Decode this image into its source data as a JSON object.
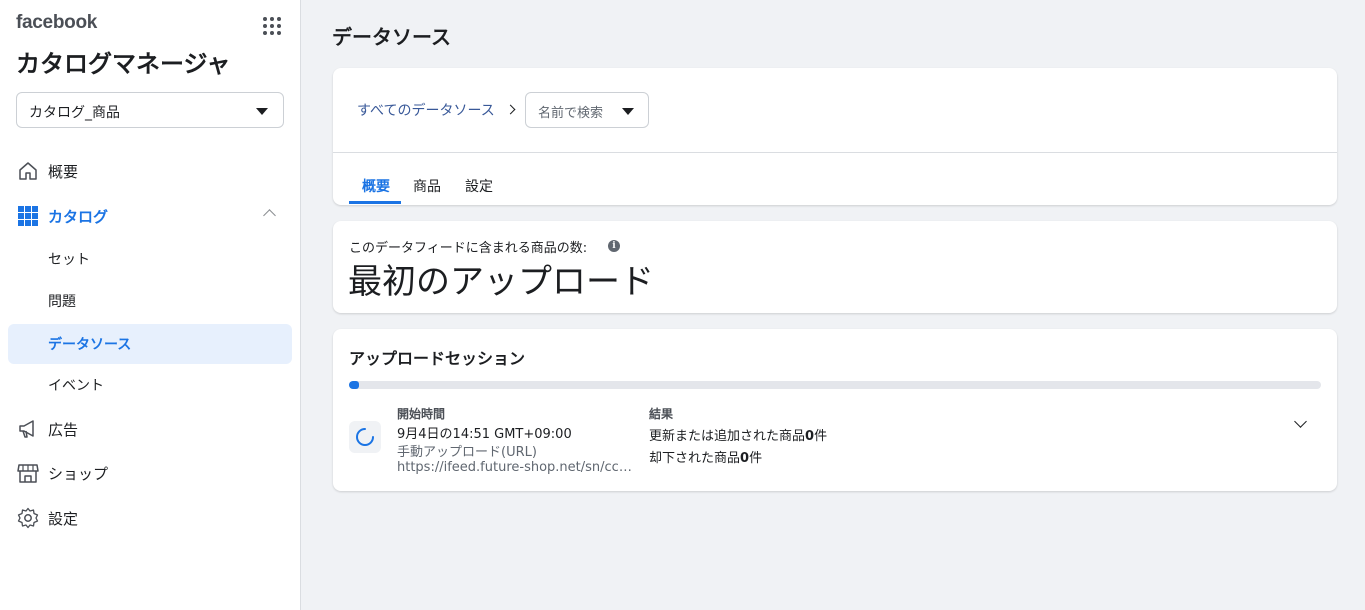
{
  "brand": "facebook",
  "app_title": "カタログマネージャ",
  "catalog_select": {
    "value": "カタログ_商品"
  },
  "nav": {
    "overview": "概要",
    "catalog": "カタログ",
    "catalog_sub": [
      "セット",
      "問題",
      "データソース",
      "イベント"
    ],
    "ads": "広告",
    "shop": "ショップ",
    "settings": "設定"
  },
  "page_heading": "データソース",
  "breadcrumb": {
    "link": "すべてのデータソース",
    "search_placeholder": "名前で検索"
  },
  "tabs": [
    "概要",
    "商品",
    "設定"
  ],
  "count_card": {
    "label": "このデータフィードに含まれる商品の数:",
    "value": "最初のアップロード"
  },
  "upload_session": {
    "title": "アップロードセッション",
    "progress_percent": 1,
    "start_header": "開始時間",
    "start_time": "9月4日の14:51 GMT+09:00",
    "method": "手動アップロード(URL)",
    "url": "https://ifeed.future-shop.net/sn/ccdo…",
    "result_header": "結果",
    "result_updated_prefix": "更新または追加された商品",
    "result_updated_count": "0",
    "result_updated_suffix": "件",
    "result_rejected_prefix": "却下された商品",
    "result_rejected_count": "0",
    "result_rejected_suffix": "件"
  },
  "colors": {
    "accent": "#1b74e4",
    "link": "#385898",
    "active_bg": "#e7f0fd"
  }
}
